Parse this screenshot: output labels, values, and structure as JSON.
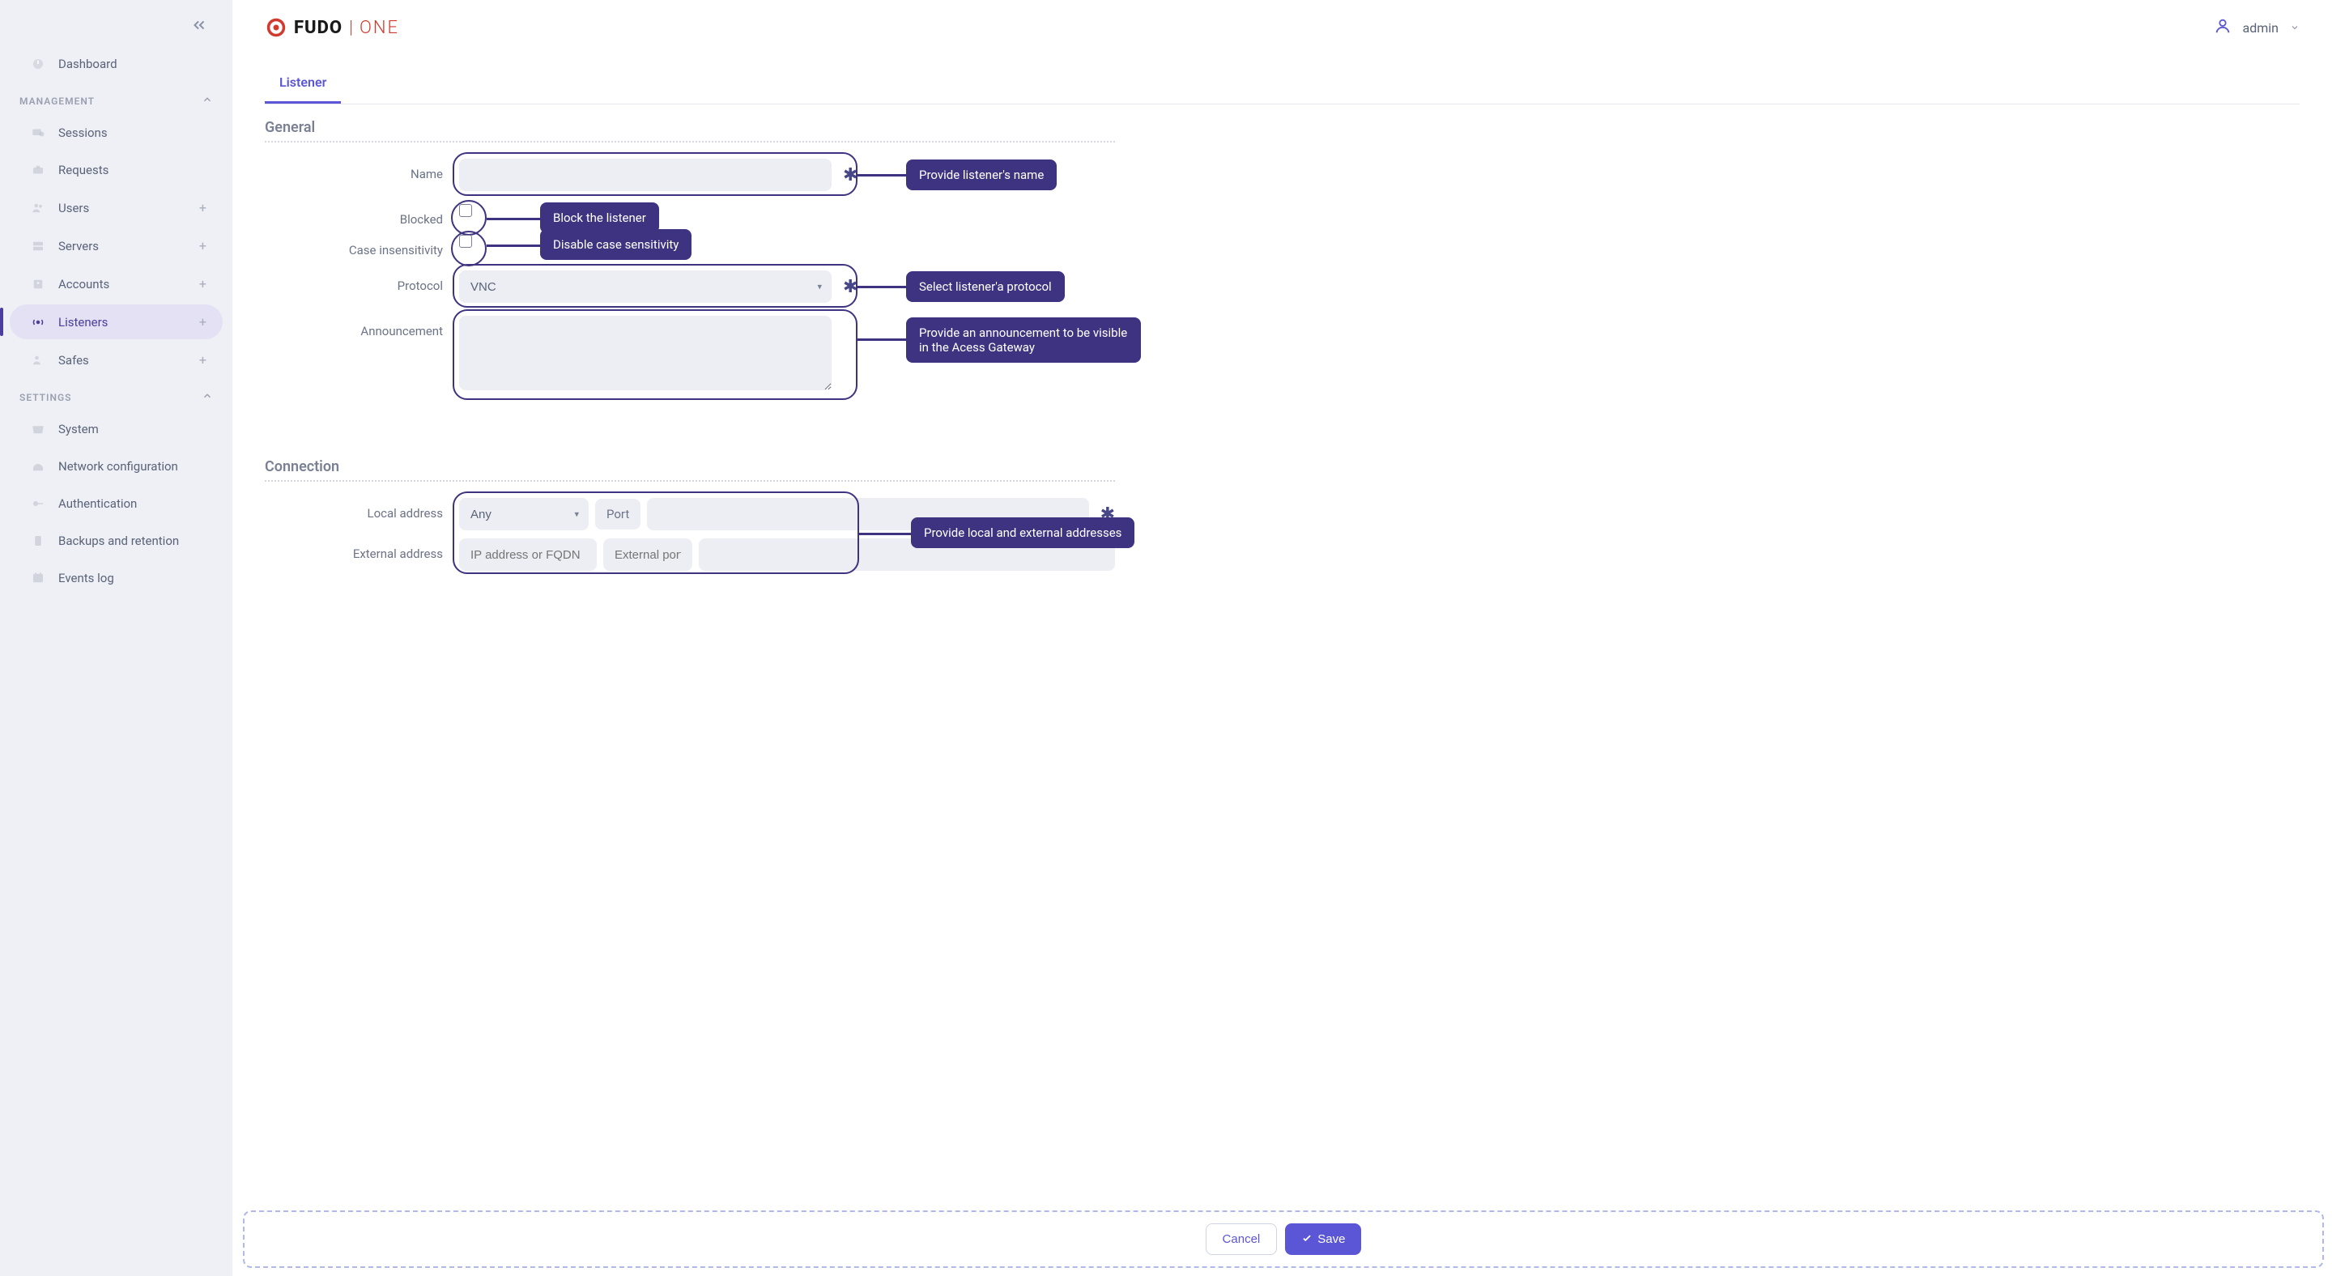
{
  "brand": {
    "primary": "FUDO",
    "secondary": "ONE"
  },
  "user": {
    "name": "admin"
  },
  "sidebar": {
    "dashboard": "Dashboard",
    "management_header": "MANAGEMENT",
    "items": [
      {
        "label": "Sessions"
      },
      {
        "label": "Requests"
      },
      {
        "label": "Users"
      },
      {
        "label": "Servers"
      },
      {
        "label": "Accounts"
      },
      {
        "label": "Listeners"
      },
      {
        "label": "Safes"
      }
    ],
    "settings_header": "SETTINGS",
    "settings": [
      {
        "label": "System"
      },
      {
        "label": "Network configuration"
      },
      {
        "label": "Authentication"
      },
      {
        "label": "Backups and retention"
      },
      {
        "label": "Events log"
      }
    ]
  },
  "tabs": {
    "listener": "Listener"
  },
  "sections": {
    "general": "General",
    "connection": "Connection"
  },
  "form": {
    "name_label": "Name",
    "blocked_label": "Blocked",
    "case_label": "Case insensitivity",
    "protocol_label": "Protocol",
    "protocol_value": "VNC",
    "announcement_label": "Announcement",
    "local_addr_label": "Local address",
    "local_addr_value": "Any",
    "port_label": "Port",
    "external_addr_label": "External address",
    "ip_placeholder": "IP address or FQDN",
    "ext_port_placeholder": "External port"
  },
  "callouts": {
    "name": "Provide listener's name",
    "blocked": "Block the listener",
    "case": "Disable case sensitivity",
    "protocol": "Select listener'a protocol",
    "announcement": "Provide an announcement to be visible in the Acess Gateway",
    "addresses": "Provide local and external addresses"
  },
  "buttons": {
    "cancel": "Cancel",
    "save": "Save"
  }
}
